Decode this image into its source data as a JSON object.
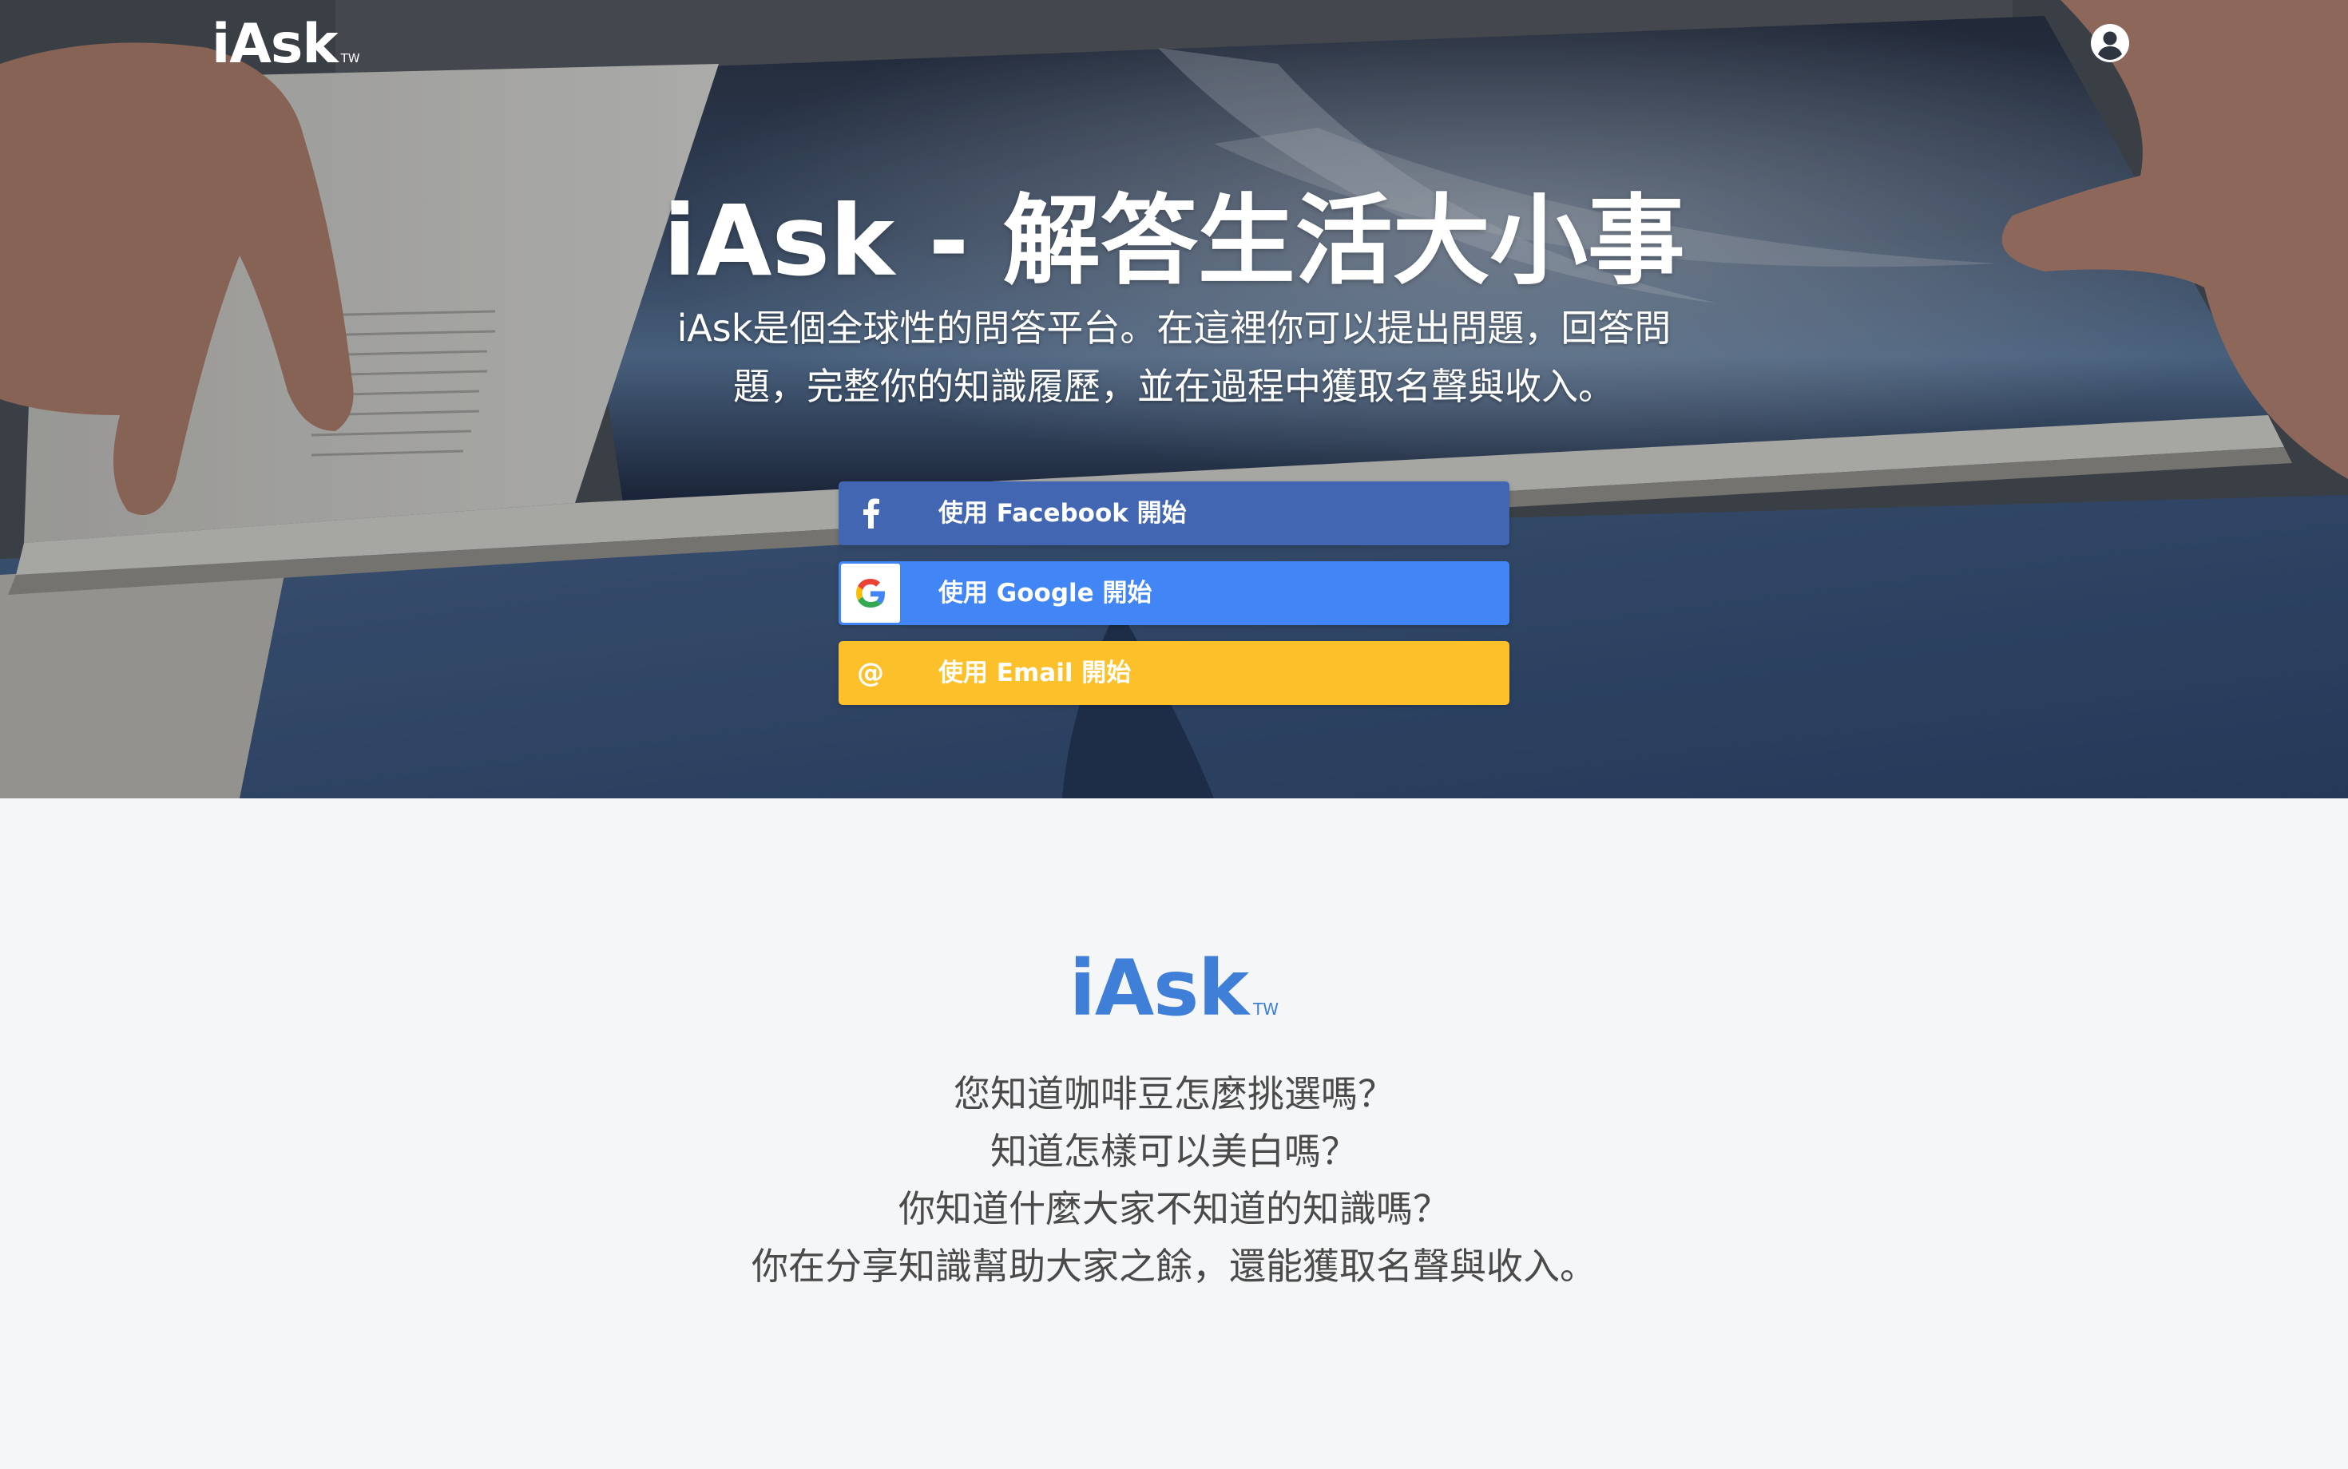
{
  "header": {
    "brand": "iAsk",
    "brand_suffix": "TW",
    "account_icon": "user-circle-icon"
  },
  "hero": {
    "title": "iAsk - 解答生活大小事",
    "subtitle_line1": "iAsk是個全球性的問答平台。在這裡你可以提出問題，回答問",
    "subtitle_line2": "題，完整你的知識履歷，並在過程中獲取名聲與收入。"
  },
  "login": {
    "facebook_label": "使用 Facebook 開始",
    "google_label": "使用 Google 開始",
    "email_label": "使用 Email 開始",
    "email_icon_glyph": "@",
    "colors": {
      "facebook": "#4266b1",
      "google": "#4286f5",
      "email": "#fcc02b"
    }
  },
  "about": {
    "logo": "iAsk",
    "logo_suffix": "TW",
    "logo_color": "#3f7fd8",
    "lines": [
      "您知道咖啡豆怎麼挑選嗎？",
      "知道怎樣可以美白嗎？",
      "你知道什麼大家不知道的知識嗎？",
      "你在分享知識幫助大家之餘，還能獲取名聲與收入。"
    ]
  }
}
